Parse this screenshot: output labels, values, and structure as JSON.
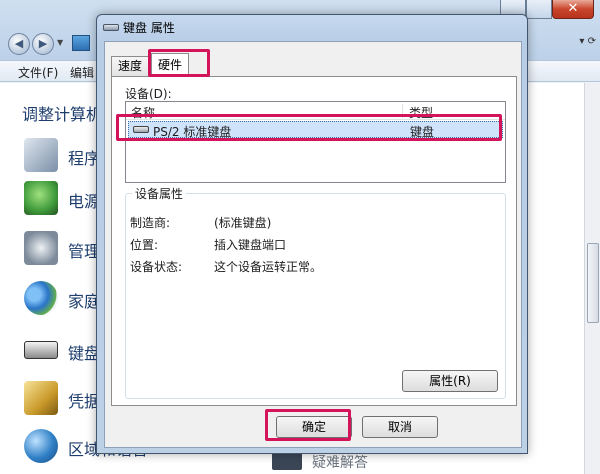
{
  "background_window": {
    "menu": [
      "文件(F)",
      "编辑"
    ],
    "heading": "调整计算机",
    "items": [
      {
        "label": "程序",
        "icon": "programs-icon",
        "color": "#7a8fa8"
      },
      {
        "label": "电源",
        "icon": "power-icon",
        "color": "#3f9a3a"
      },
      {
        "label": "管理",
        "icon": "admin-tools-icon",
        "color": "#7c8a99"
      },
      {
        "label": "家庭",
        "icon": "homegroup-icon",
        "color": "#2a74c8"
      },
      {
        "label": "键盘",
        "icon": "keyboard-icon",
        "color": "#4a4a4a"
      },
      {
        "label": "凭据",
        "icon": "credential-icon",
        "color": "#c99a2a"
      },
      {
        "label": "区域和语言",
        "icon": "region-globe-icon",
        "color": "#2f7fc6"
      }
    ],
    "taskbar_text": "疑难解答"
  },
  "dialog": {
    "title": "键盘 属性",
    "tabs": [
      {
        "label": "速度",
        "selected": false
      },
      {
        "label": "硬件",
        "selected": true
      }
    ],
    "devices_label": "设备(D):",
    "columns": {
      "name": "名称",
      "type": "类型"
    },
    "devices": [
      {
        "name": "PS/2 标准键盘",
        "type": "键盘",
        "selected": true
      }
    ],
    "properties": {
      "legend": "设备属性",
      "rows": [
        {
          "key": "制造商:",
          "value": "(标准键盘)"
        },
        {
          "key": "位置:",
          "value": "插入键盘端口"
        },
        {
          "key": "设备状态:",
          "value": "这个设备运转正常。"
        }
      ],
      "button": "属性(R)"
    },
    "ok_button": "确定",
    "cancel_button": "取消"
  },
  "colors": {
    "highlight": "#d4145a",
    "selection": "#cfe3fa"
  }
}
